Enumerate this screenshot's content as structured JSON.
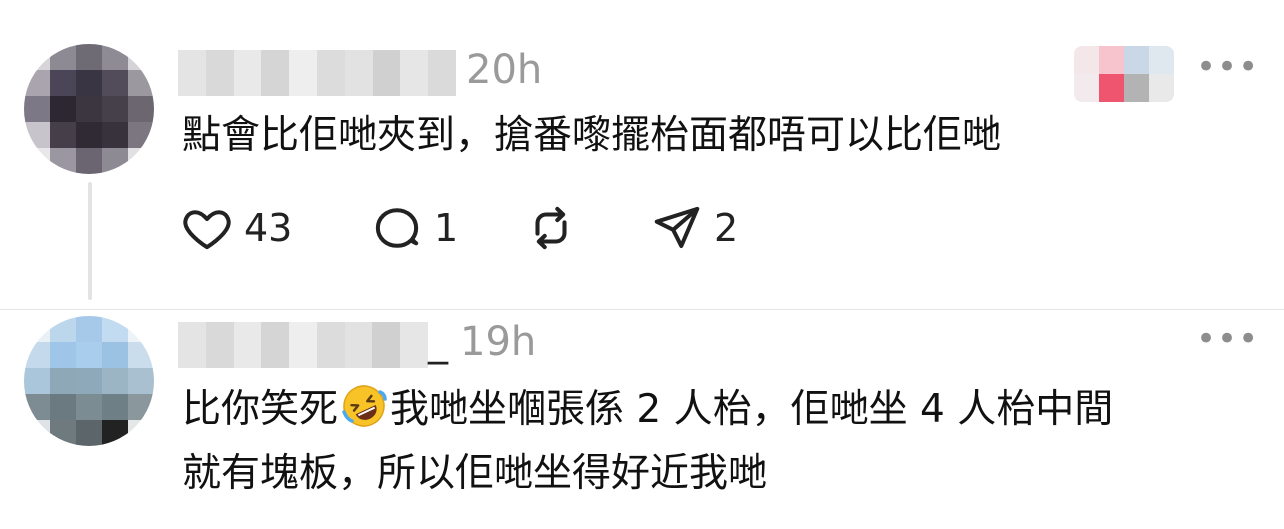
{
  "comments": [
    {
      "time": "20h",
      "text": "點會比佢哋夾到，搶番嚟擺枱面都唔可以比佢哋",
      "likes": "43",
      "replies": "1",
      "shares": "2",
      "more_icon": "more-horizontal-icon"
    },
    {
      "name_suffix": "_",
      "time": "19h",
      "text_line1_before_emoji": "比你笑死",
      "emoji": "rolling-on-floor-laughing",
      "text_line1_after_emoji": "我哋坐嗰張係 2 人枱，佢哋坐 4 人枱中間",
      "text_line2": "就有塊板，所以佢哋坐得好近我哋",
      "more_icon": "more-horizontal-icon"
    }
  ],
  "icons": [
    "heart-icon",
    "comment-icon",
    "repost-icon",
    "share-icon"
  ]
}
